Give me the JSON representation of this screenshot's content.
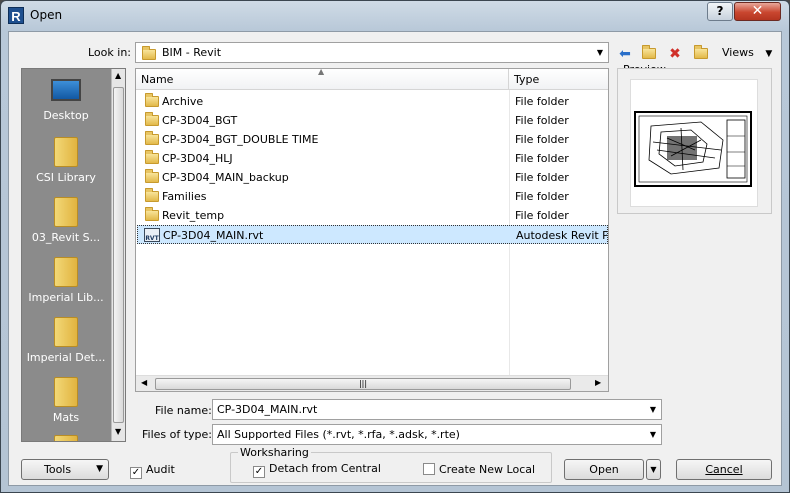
{
  "window": {
    "title": "Open",
    "help_label": "?",
    "close_label": "✕",
    "app_icon": "R"
  },
  "look_in": {
    "label": "Look in:",
    "value": "BIM - Revit"
  },
  "toolbar": {
    "views_label": "Views"
  },
  "places": [
    {
      "label": "Desktop",
      "icon": "desktop-icon"
    },
    {
      "label": "CSI Library",
      "icon": "folder-icon"
    },
    {
      "label": "03_Revit S...",
      "icon": "folder-icon"
    },
    {
      "label": "Imperial Lib...",
      "icon": "folder-icon"
    },
    {
      "label": "Imperial Det...",
      "icon": "folder-icon"
    },
    {
      "label": "Mats",
      "icon": "folder-icon"
    }
  ],
  "file_list": {
    "columns": [
      "Name",
      "Type"
    ],
    "rows": [
      {
        "name": "Archive",
        "type": "File folder"
      },
      {
        "name": "CP-3D04_BGT",
        "type": "File folder"
      },
      {
        "name": "CP-3D04_BGT_DOUBLE TIME",
        "type": "File folder"
      },
      {
        "name": "CP-3D04_HLJ",
        "type": "File folder"
      },
      {
        "name": "CP-3D04_MAIN_backup",
        "type": "File folder"
      },
      {
        "name": "Families",
        "type": "File folder"
      },
      {
        "name": "Revit_temp",
        "type": "File folder"
      },
      {
        "name": "CP-3D04_MAIN.rvt",
        "type": "Autodesk Revit Pr",
        "icon_text": "RVT"
      }
    ]
  },
  "preview": {
    "label": "Preview"
  },
  "file_name": {
    "label": "File name:",
    "value": "CP-3D04_MAIN.rvt"
  },
  "files_of_type": {
    "label": "Files of type:",
    "value": "All Supported Files  (*.rvt, *.rfa, *.adsk, *.rte)"
  },
  "bottom": {
    "tools_label": "Tools",
    "audit_label": "Audit",
    "worksharing_label": "Worksharing",
    "detach_label": "Detach from Central",
    "create_new_local_label": "Create New Local",
    "open_label": "Open",
    "cancel_label": "Cancel"
  }
}
